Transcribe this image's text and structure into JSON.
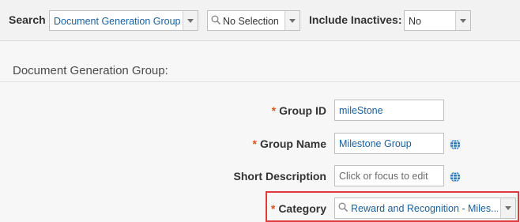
{
  "toolbar": {
    "search_label": "Search",
    "search_value": "Document Generation Group",
    "selection_value": "No Selection",
    "inactives_label": "Include Inactives:",
    "inactives_value": "No"
  },
  "section": {
    "title": "Document Generation Group:"
  },
  "form": {
    "required_marker": "*",
    "group_id": {
      "label": "Group ID",
      "value": "mileStone"
    },
    "group_name": {
      "label": "Group Name",
      "value": "Milestone Group"
    },
    "short_description": {
      "label": "Short Description",
      "placeholder": "Click or focus to edit"
    },
    "category": {
      "label": "Category",
      "value": "Reward and Recognition - Miles..."
    }
  },
  "colors": {
    "accent_link": "#1a5f9e",
    "required": "#d9531e",
    "highlight_border": "#e0393e",
    "globe_icon": "#1f6fb5"
  }
}
